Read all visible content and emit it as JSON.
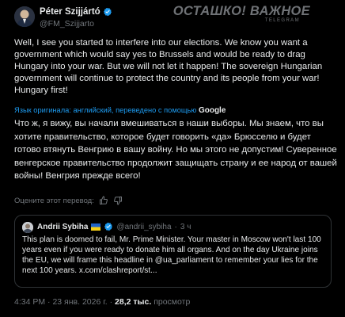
{
  "author": {
    "name": "Péter Szijjártó",
    "handle": "@FM_Szijjarto"
  },
  "watermark": {
    "title": "ОСТАШКО! ВАЖНОЕ",
    "subtitle": "TELEGRAM"
  },
  "tweet": {
    "text": "Well, I see you started to interfere into our elections. We know you want a government which would say yes to Brussels and would be ready to drag Hungary into your war. But we will not let it happen! The sovereign Hungarian government will continue to protect the country and its people from your war! Hungary first!",
    "translation_note": "Язык оригинала: английский, переведено с помощью",
    "translation_provider": "Google",
    "translated_text": "Что ж, я вижу, вы начали вмешиваться в наши выборы. Мы знаем, что вы хотите правительство, которое будет говорить «да» Брюсселю и будет готово втянуть Венгрию в вашу войну. Но мы этого не допустим! Суверенное венгерское правительство продолжит защищать страну и ее народ от вашей войны! Венгрия прежде всего!",
    "rate_prompt": "Оцените этот перевод:"
  },
  "quote": {
    "name": "Andrii Sybiha",
    "handle": "@andrii_sybiha",
    "separator": "·",
    "time": "3 ч",
    "text": "This plan is doomed to fail, Mr. Prime Minister. Your master in Moscow won't last 100 years even if you were ready to donate him all organs. And on the day Ukraine joins the EU, we will frame this headline in @ua_parliament to remember your lies for the next 100 years. x.com/clashreport/st..."
  },
  "meta": {
    "time": "4:34 PM",
    "date": "23 янв. 2026 г.",
    "separator": "·",
    "views_count": "28,2 тыс.",
    "views_label": "просмотр"
  },
  "colors": {
    "background": "#000000",
    "text": "#e7e9ea",
    "muted": "#71767b",
    "link": "#1d9bf0",
    "border": "#2f3336",
    "verified": "#1d9bf0"
  }
}
